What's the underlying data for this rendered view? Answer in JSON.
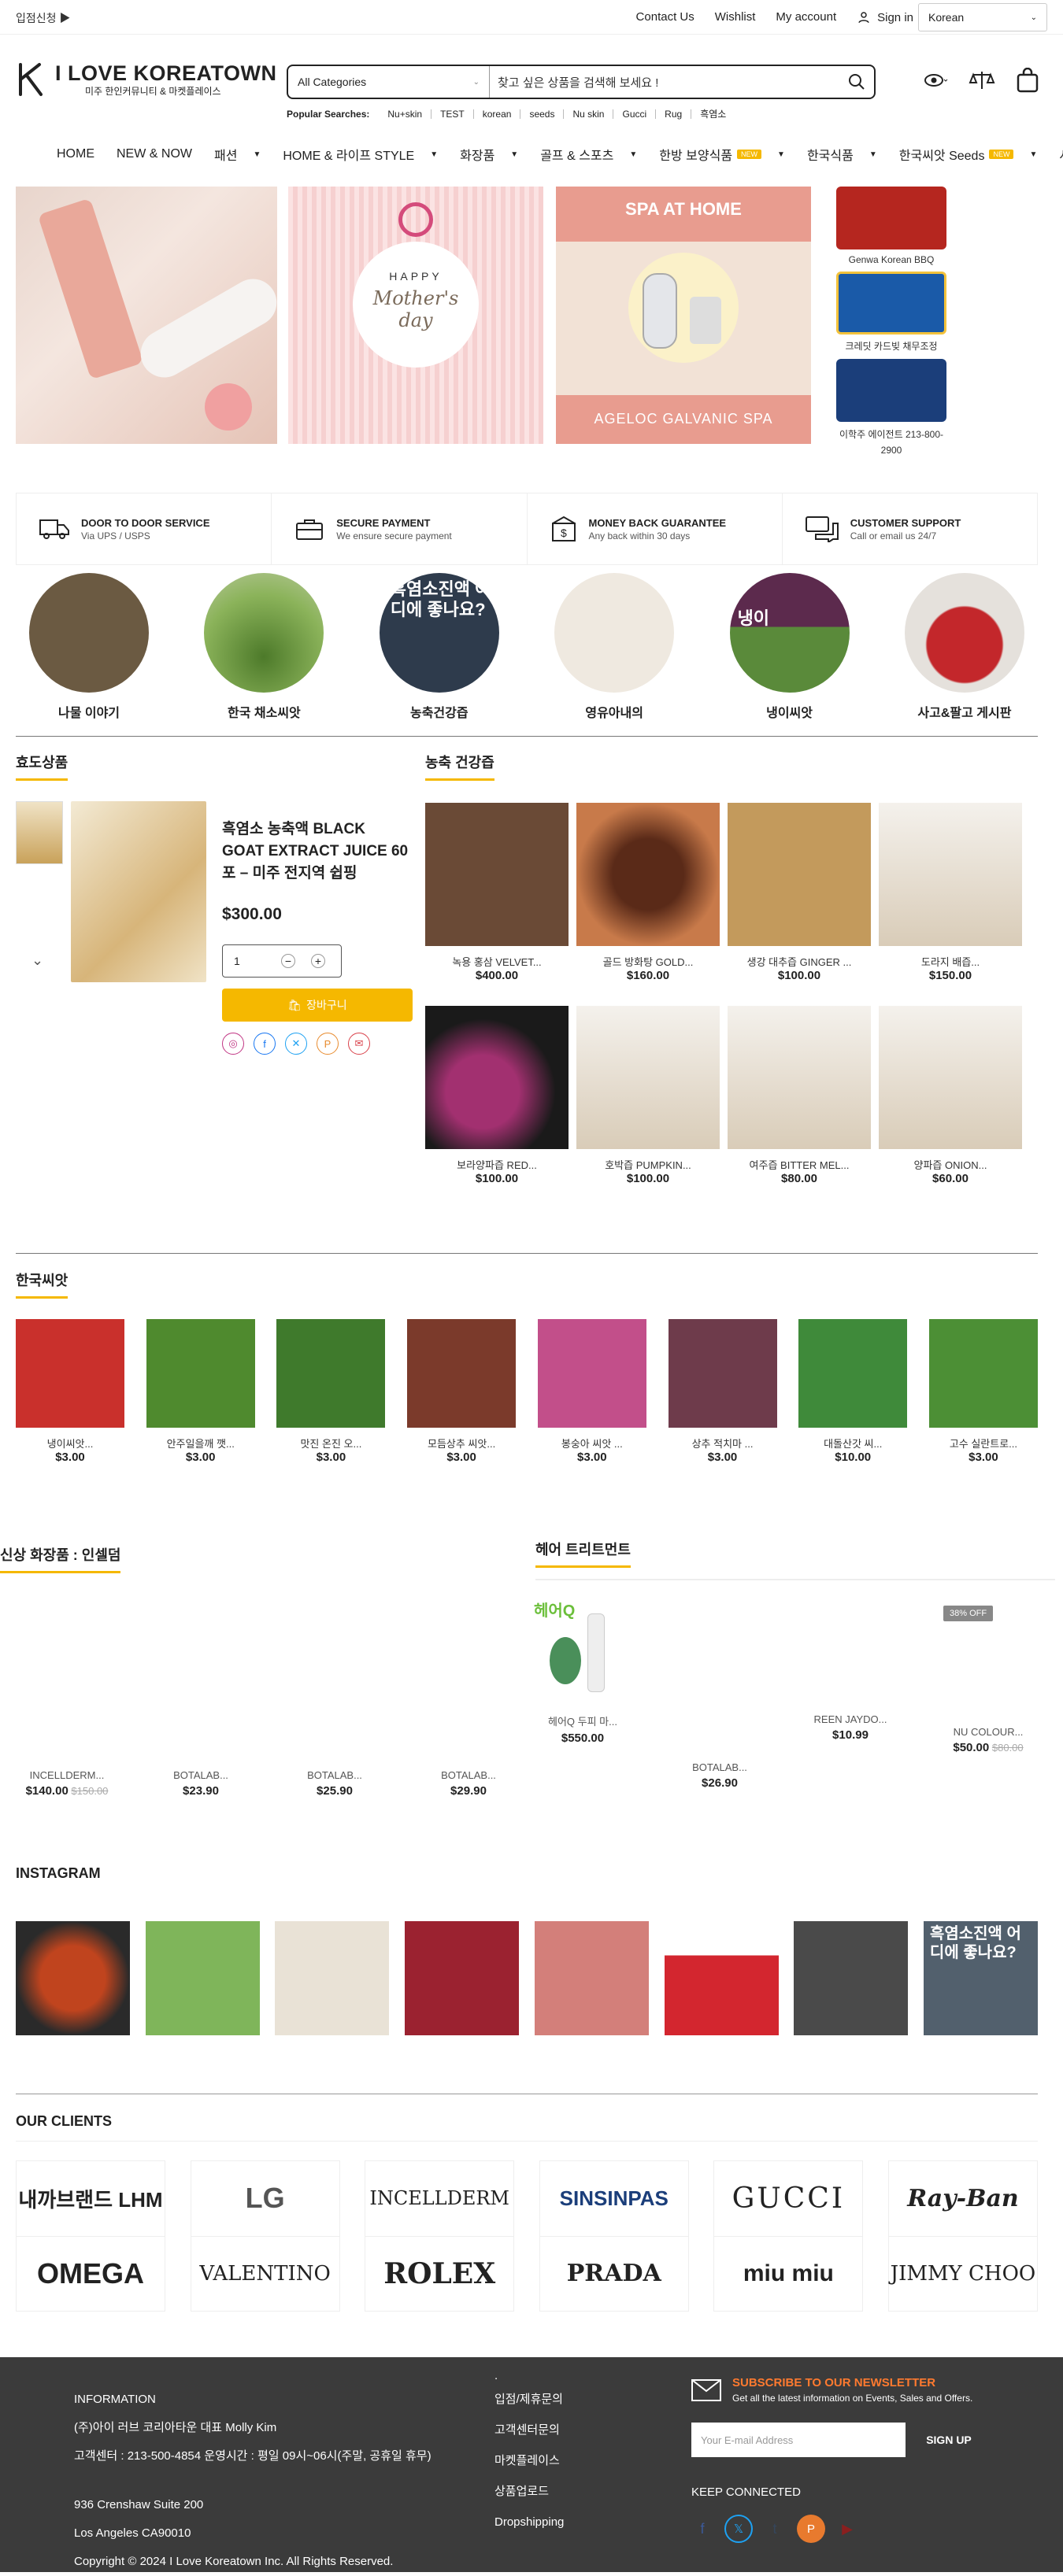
{
  "topbar": {
    "register": "입점신청 ▶",
    "links": [
      "Contact Us",
      "Wishlist",
      "My account"
    ],
    "signin": "Sign in",
    "language": "Korean"
  },
  "header": {
    "logo_title": "I LOVE KOREATOWN",
    "logo_sub": "미주 한인커뮤니티 & 마켓플레이스",
    "category": "All Categories",
    "search_placeholder": "찾고 싶은 상품을 검색해 보세요 !",
    "popular_label": "Popular Searches:",
    "popular": [
      "Nu+skin",
      "TEST",
      "korean",
      "seeds",
      "Nu skin",
      "Gucci",
      "Rug",
      "흑염소"
    ]
  },
  "nav": [
    {
      "label": "HOME"
    },
    {
      "label": "NEW & NOW"
    },
    {
      "label": "패션",
      "dropdown": true
    },
    {
      "label": "HOME & 라이프 STYLE",
      "dropdown": true
    },
    {
      "label": "화장품",
      "dropdown": true
    },
    {
      "label": "골프 & 스포츠",
      "dropdown": true
    },
    {
      "label": "한방 보양식품",
      "badge": "NEW",
      "dropdown": true
    },
    {
      "label": "한국식품",
      "dropdown": true
    },
    {
      "label": "한국씨앗 Seeds",
      "badge": "NEW",
      "dropdown": true
    },
    {
      "label": "사고"
    }
  ],
  "banners": {
    "b2_top": "HAPPY",
    "b2_text": "Mother's day",
    "b3_top": "SPA AT HOME",
    "b3_bottom": "AGELOC GALVANIC SPA"
  },
  "ads": [
    {
      "label": "Genwa Korean BBQ",
      "color": "#b5261f"
    },
    {
      "label": "크레딧 카드빚 채무조정",
      "color": "#1a5aa8"
    },
    {
      "label": "이학주 에이전트 213-800-2900",
      "color": "#1b3e7a"
    }
  ],
  "services": [
    {
      "title": "DOOR TO DOOR SERVICE",
      "desc": "Via UPS / USPS"
    },
    {
      "title": "SECURE PAYMENT",
      "desc": "We ensure secure payment"
    },
    {
      "title": "MONEY BACK GUARANTEE",
      "desc": "Any back within 30 days"
    },
    {
      "title": "CUSTOMER SUPPORT",
      "desc": "Call or email us 24/7"
    }
  ],
  "categories": [
    {
      "label": "나물 이야기",
      "color": "#6b5a42"
    },
    {
      "label": "한국 채소씨앗",
      "color": "#6d8a3d"
    },
    {
      "label": "농축건강즙",
      "color": "#2e3b4c",
      "overlay": "흑염소진액 어디에 좋나요?"
    },
    {
      "label": "영유아내의",
      "color": "#d9cfc0"
    },
    {
      "label": "냉이씨앗",
      "color": "#5c2a4d",
      "overlay": "냉이"
    },
    {
      "label": "사고&팔고 게시판",
      "color": "#c3272b"
    }
  ],
  "featured": {
    "section": "효도상품",
    "name": "흑염소 농축액 BLACK GOAT EXTRACT JUICE 60포 – 미주 전지역 쉽핑",
    "price": "$300.00",
    "qty": "1",
    "cart": "장바구니"
  },
  "health": {
    "section": "농축 건강즙",
    "items": [
      {
        "name": "녹용 홍삼 VELVET...",
        "price": "$400.00",
        "color": "#6a4a36"
      },
      {
        "name": "골드 방화탕 GOLD...",
        "price": "$160.00",
        "color": "#7a3b24"
      },
      {
        "name": "생강 대추즙 GINGER ...",
        "price": "$100.00",
        "color": "#c39a5c"
      },
      {
        "name": "도라지 배즙...",
        "price": "$150.00",
        "color": "#e6ddd2"
      },
      {
        "name": "보라양파즙 RED...",
        "price": "$100.00",
        "color": "#5a1e42"
      },
      {
        "name": "호박즙 PUMPKIN...",
        "price": "$100.00",
        "color": "#e6ddd2"
      },
      {
        "name": "여주즙 BITTER MEL...",
        "price": "$80.00",
        "color": "#e6ddd2"
      },
      {
        "name": "양파즙 ONION...",
        "price": "$60.00",
        "color": "#e6ddd2"
      }
    ]
  },
  "seeds": {
    "section": "한국씨앗",
    "items": [
      {
        "name": "냉이씨앗...",
        "price": "$3.00",
        "color": "#c9302c"
      },
      {
        "name": "안주일을깨 깻...",
        "price": "$3.00",
        "color": "#4f8a2e"
      },
      {
        "name": "맛진 온진 오...",
        "price": "$3.00",
        "color": "#3f7a2c"
      },
      {
        "name": "모듬상추 씨앗...",
        "price": "$3.00",
        "color": "#7b3a2b"
      },
      {
        "name": "봉숭아 씨앗 ...",
        "price": "$3.00",
        "color": "#c24f8a"
      },
      {
        "name": "상추 적치마 ...",
        "price": "$3.00",
        "color": "#6e3b4b"
      },
      {
        "name": "대돌산갓 씨...",
        "price": "$10.00",
        "color": "#3f8a3a"
      },
      {
        "name": "고수 실란트로...",
        "price": "$3.00",
        "color": "#4c8f35"
      }
    ]
  },
  "cosmetics": {
    "section": "신상 화장품 : 인셀덤",
    "items": [
      {
        "name": "INCELLDERM...",
        "price": "$140.00",
        "old": "$150.00"
      },
      {
        "name": "BOTALAB...",
        "price": "$23.90"
      },
      {
        "name": "BOTALAB...",
        "price": "$25.90"
      },
      {
        "name": "BOTALAB...",
        "price": "$29.90"
      }
    ]
  },
  "hair": {
    "section": "헤어 트리트먼트",
    "items": [
      {
        "name": "헤어Q 두피 마...",
        "price": "$550.00"
      },
      {
        "name": "BOTALAB...",
        "price": "$26.90"
      },
      {
        "name": "REEN JAYDO...",
        "price": "$10.99"
      },
      {
        "name": "NU COLOUR...",
        "price": "$50.00",
        "old": "$80.00",
        "badge": "38% OFF"
      }
    ],
    "brand": "헤어Q"
  },
  "instagram": {
    "title": "INSTAGRAM",
    "colors": [
      "#8a3a1e",
      "#7fb55a",
      "#e9e2d6",
      "#9b2230",
      "#d37f7a",
      "#d3262f",
      "#4a4a4a",
      "#52606d"
    ],
    "overlay": "흑염소진액 어디에 좋나요?"
  },
  "clients": {
    "title": "OUR CLIENTS",
    "logos": [
      [
        "내까브랜드 LHM",
        "OMEGA"
      ],
      [
        "LG",
        "VALENTINO"
      ],
      [
        "INCELLDERM",
        "ROLEX"
      ],
      [
        "SINSINPAS",
        "PRADA"
      ],
      [
        "GUCCI",
        "miu miu"
      ],
      [
        "Ray-Ban",
        "JIMMY CHOO"
      ]
    ]
  },
  "footer": {
    "info_title": "INFORMATION",
    "company": "(주)아이 러브 코리아타운     대표 Molly Kim",
    "phone": "고객센터 : 213-500-4854    운영시간 : 평일 09시~06시(주말, 공휴일 휴무)",
    "addr1": "936 Crenshaw Suite 200",
    "addr2": "Los Angeles CA90010",
    "copyright": "Copyright © 2024 I Love Koreatown Inc.  All Rights Reserved.",
    "dot": ".",
    "links": [
      "입점/제휴문의",
      "고객센터문의",
      "마켓플레이스",
      "상품업로드",
      "Dropshipping"
    ],
    "newsletter": "SUBSCRIBE TO OUR NEWSLETTER",
    "newsletter_sub": "Get all the latest information on Events, Sales and Offers.",
    "email_placeholder": "Your E-mail Address",
    "signup": "SIGN UP",
    "keep": "KEEP CONNECTED"
  }
}
